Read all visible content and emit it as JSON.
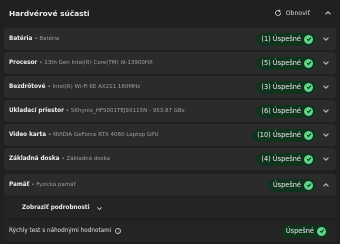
{
  "header": {
    "title": "Hardvérové súčasti",
    "refresh_label": "Obnoviť",
    "icons": {
      "refresh": "refresh-icon",
      "collapse": "chevron-up-icon"
    }
  },
  "colors": {
    "success_bg": "#10331e",
    "success_check": "#5fd48a",
    "row_bg": "#2b2b2b"
  },
  "components": [
    {
      "name": "Batéria",
      "detail": "Batéria",
      "badge": "(1) Úspešné"
    },
    {
      "name": "Procesor",
      "detail": "13th Gen Intel(R) Core(TM) i9-13900HX",
      "badge": "(5) Úspešné"
    },
    {
      "name": "Bezdrôtové",
      "detail": "Intel(R) Wi-Fi 6E AX211 160MHz",
      "badge": "(3) Úspešné"
    },
    {
      "name": "Ukladací priestor",
      "detail": "SKhynix_HFS001TEJ9X115N - 953.87 GBs",
      "badge": "(6) Úspešné"
    },
    {
      "name": "Video karta",
      "detail": "NVIDIA GeForce RTX 4060 Laptop GPU",
      "badge": "(10) Úspešné"
    },
    {
      "name": "Základná doska",
      "detail": "Základná doska",
      "badge": "(4) Úspešné"
    },
    {
      "name": "Pamäť",
      "detail": "Fyzická pamäť",
      "badge": "Úspešné"
    }
  ],
  "memory_expanded": {
    "details_label": "Zobraziť podrobnosti",
    "quick_test_label": "Rýchly test s náhodnými hodnotami",
    "quick_test_badge": "Úspešné"
  }
}
